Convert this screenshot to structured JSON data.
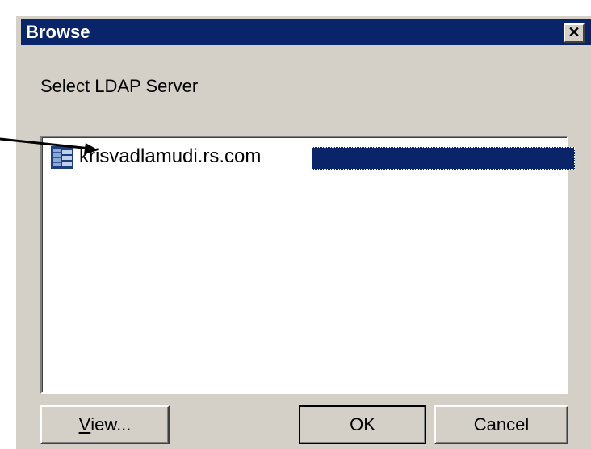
{
  "dialog": {
    "title": "Browse",
    "close_label": "✕",
    "prompt": "Select LDAP Server",
    "list": {
      "items": [
        {
          "label": "krisvadlamudi.rs.com",
          "icon": "server-icon",
          "selected": true
        }
      ]
    },
    "buttons": {
      "view_mnemonic": "V",
      "view_rest": "iew...",
      "ok": "OK",
      "cancel": "Cancel"
    }
  },
  "colors": {
    "titlebar": "#0a246a",
    "face": "#d4d0c8",
    "selection": "#0a246a"
  }
}
